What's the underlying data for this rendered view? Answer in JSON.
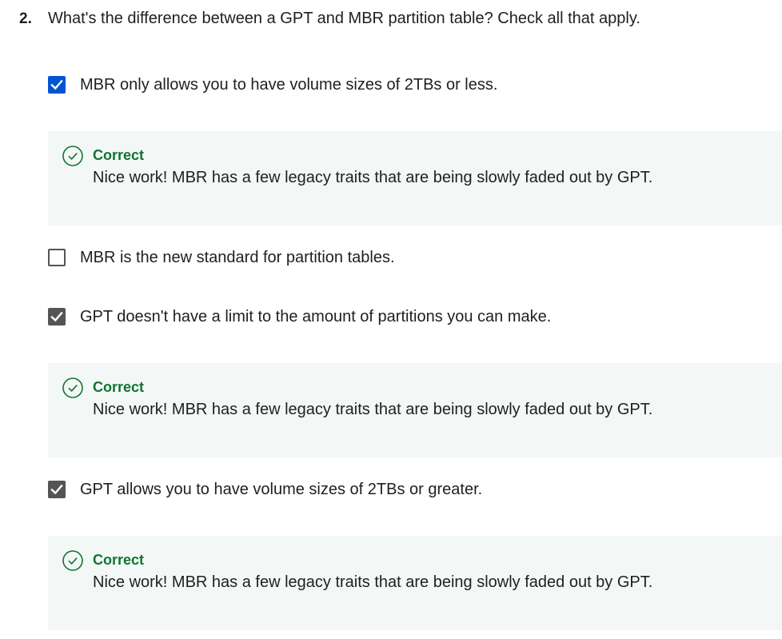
{
  "question": {
    "number": "2.",
    "text": "What's the difference between a GPT and MBR partition table? Check all that apply."
  },
  "options": [
    {
      "label": "MBR only allows you to have volume sizes of 2TBs or less.",
      "checked": true,
      "feedback": {
        "title": "Correct",
        "text": "Nice work! MBR has a few legacy traits that are being slowly faded out by GPT."
      }
    },
    {
      "label": "MBR is the new standard for partition tables.",
      "checked": false
    },
    {
      "label": "GPT doesn't have a limit to the amount of partitions you can make.",
      "checked": true,
      "feedback": {
        "title": "Correct",
        "text": "Nice work! MBR has a few legacy traits that are being slowly faded out by GPT."
      }
    },
    {
      "label": "GPT allows you to have volume sizes of 2TBs or greater.",
      "checked": true,
      "feedback": {
        "title": "Correct",
        "text": "Nice work! MBR has a few legacy traits that are being slowly faded out by GPT."
      }
    }
  ],
  "colors": {
    "checkbox_focused": "#0056d2",
    "checkbox_checked": "#545454",
    "correct_green": "#137333",
    "feedback_bg": "#f3f8f6"
  },
  "icons": {
    "checkmark": "checkmark-icon",
    "correct": "correct-check-circle-icon"
  }
}
